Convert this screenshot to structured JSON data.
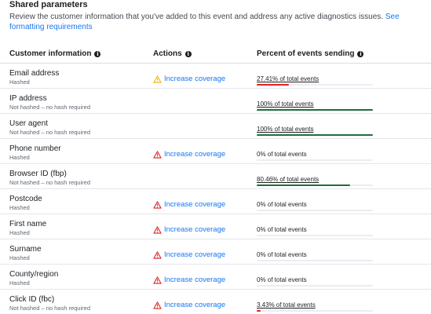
{
  "section": {
    "title": "Shared parameters",
    "description": "Review the customer information that you've added to this event and address any active diagnostics issues.",
    "link_text": "See formatting requirements"
  },
  "headers": {
    "customer_info": "Customer information",
    "actions": "Actions",
    "percent": "Percent of events sending"
  },
  "colors": {
    "link": "#1877f2",
    "good": "#1e6f3a",
    "bad": "#e02020",
    "warning_yellow": "#f0b400",
    "warning_red": "#e02020"
  },
  "rows": [
    {
      "name": "Email address",
      "hashing": "Hashed",
      "action": "Increase coverage",
      "action_icon": "warning-yellow-icon",
      "percent_label": "27.41% of total events",
      "percent": 27.41,
      "status": "bad",
      "underline": true
    },
    {
      "name": "IP address",
      "hashing": "Not hashed – no hash required",
      "action": "",
      "action_icon": "",
      "percent_label": "100% of total events",
      "percent": 100,
      "status": "good",
      "underline": true
    },
    {
      "name": "User agent",
      "hashing": "Not hashed – no hash required",
      "action": "",
      "action_icon": "",
      "percent_label": "100% of total events",
      "percent": 100,
      "status": "good",
      "underline": true
    },
    {
      "name": "Phone number",
      "hashing": "Hashed",
      "action": "Increase coverage",
      "action_icon": "warning-red-icon",
      "percent_label": "0% of total events",
      "percent": 0,
      "status": "none",
      "underline": false
    },
    {
      "name": "Browser ID (fbp)",
      "hashing": "Not hashed – no hash required",
      "action": "",
      "action_icon": "",
      "percent_label": "80.46% of total events",
      "percent": 80.46,
      "status": "good",
      "underline": true
    },
    {
      "name": "Postcode",
      "hashing": "Hashed",
      "action": "Increase coverage",
      "action_icon": "warning-red-icon",
      "percent_label": "0% of total events",
      "percent": 0,
      "status": "none",
      "underline": false
    },
    {
      "name": "First name",
      "hashing": "Hashed",
      "action": "Increase coverage",
      "action_icon": "warning-red-icon",
      "percent_label": "0% of total events",
      "percent": 0,
      "status": "none",
      "underline": false
    },
    {
      "name": "Surname",
      "hashing": "Hashed",
      "action": "Increase coverage",
      "action_icon": "warning-red-icon",
      "percent_label": "0% of total events",
      "percent": 0,
      "status": "none",
      "underline": false
    },
    {
      "name": "County/region",
      "hashing": "Hashed",
      "action": "Increase coverage",
      "action_icon": "warning-red-icon",
      "percent_label": "0% of total events",
      "percent": 0,
      "status": "none",
      "underline": false
    },
    {
      "name": "Click ID (fbc)",
      "hashing": "Not hashed – no hash required",
      "action": "Increase coverage",
      "action_icon": "warning-red-icon",
      "percent_label": "3.43% of total events",
      "percent": 3.43,
      "status": "bad",
      "underline": true
    }
  ]
}
